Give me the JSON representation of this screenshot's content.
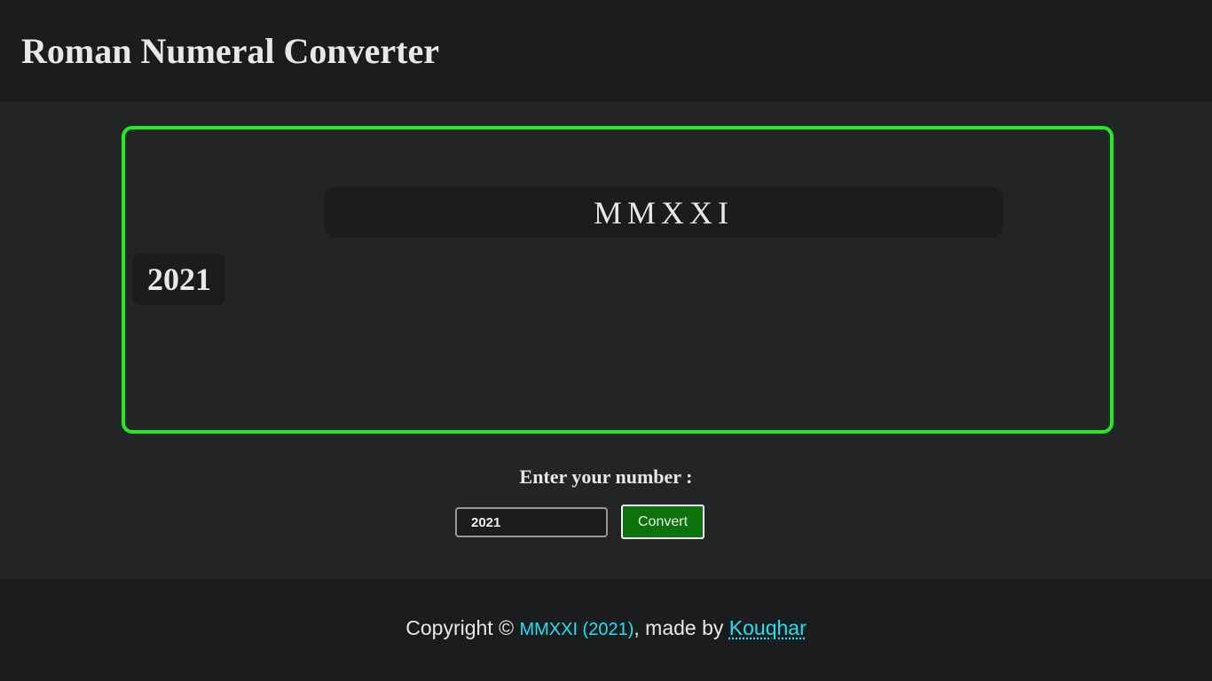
{
  "header": {
    "title": "Roman Numeral Converter"
  },
  "display": {
    "roman": "MMXXI",
    "number": "2021"
  },
  "form": {
    "label": "Enter your number :",
    "input_value": "2021",
    "button_label": "Convert"
  },
  "footer": {
    "copyright_prefix": "Copyright ©",
    "highlight": "MMXXI (2021)",
    "made_by": ", made by",
    "author_link": "Kouqhar"
  },
  "colors": {
    "accent_border": "#1ded1d",
    "button_bg": "#0c720c",
    "link": "#1fe2f0"
  }
}
